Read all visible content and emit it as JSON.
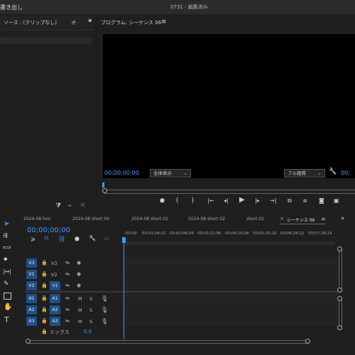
{
  "titlebar": {
    "left": "書き出し",
    "center": "0731 - 編集済み"
  },
  "source_panel": {
    "title": "ソース : (クリップなし)",
    "more": "オ·",
    "expand": "»"
  },
  "program_panel": {
    "title": "プログラム: シーケンス 06",
    "menu": "≡",
    "timecode": "00;00;00;00",
    "zoom_select": "全体表示",
    "quality_select": "フル画質",
    "right_timecode": "00;"
  },
  "timeline": {
    "tabs": [
      {
        "label": "2024-08 hon"
      },
      {
        "label": "2024-08 short 00"
      },
      {
        "label": "2024-08 short 01"
      },
      {
        "label": "2024-08 short 02"
      },
      {
        "label": "short 01"
      },
      {
        "label": "シーケンス 06"
      }
    ],
    "close_mark": "×",
    "menu": "≡",
    "expand": "»",
    "timecode": "00;00;00;00",
    "ruler": [
      ":00;00",
      "00;01;04;02",
      "00;02;08;04",
      "00;03;12;06",
      "00;04;16;08",
      "00;05;20;10",
      "00;06;24;12",
      "00;07;28;14"
    ],
    "video_tracks": [
      {
        "src": "V3",
        "tgt": "V3"
      },
      {
        "src": "V1",
        "tgt": "V2"
      },
      {
        "src": "V2",
        "tgt": "V1"
      }
    ],
    "audio_tracks": [
      {
        "src": "A1",
        "tgt": "A1"
      },
      {
        "src": "A2",
        "tgt": "A2"
      },
      {
        "src": "A3",
        "tgt": "A3"
      }
    ],
    "mute": "M",
    "solo": "S",
    "mix_label": "ミックス",
    "mix_value": "0.0"
  },
  "transport": {
    "mark_in": "{",
    "mark_out": "}"
  },
  "colors": {
    "accent": "#3a9cff",
    "track_blue": "#204f85",
    "background": "#1d1d1d"
  }
}
